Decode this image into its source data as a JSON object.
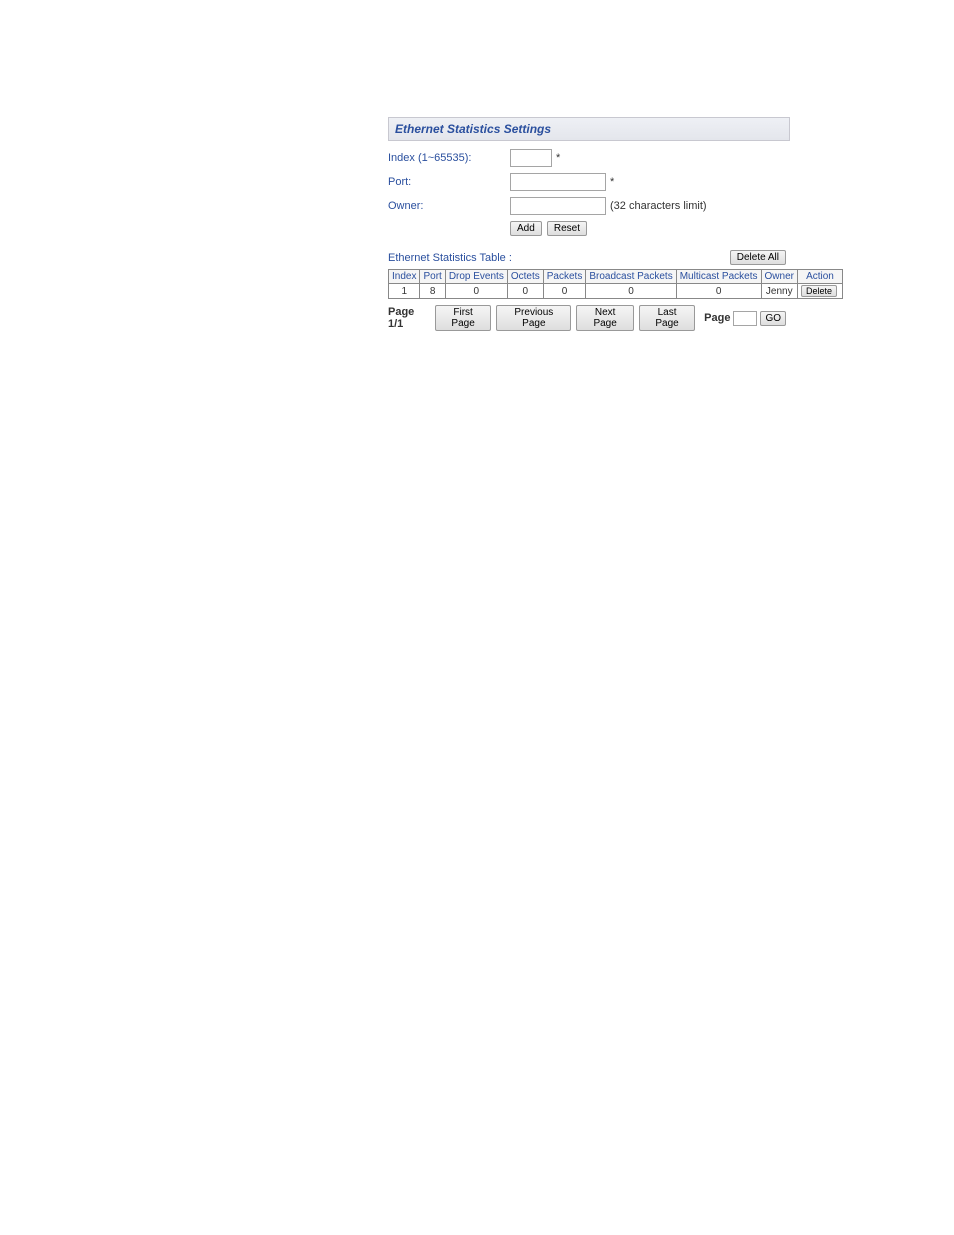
{
  "title": "Ethernet Statistics Settings",
  "form": {
    "index_label": "Index (1~65535):",
    "index_value": "",
    "index_star": "*",
    "port_label": "Port:",
    "port_value": "",
    "port_star": "*",
    "owner_label": "Owner:",
    "owner_value": "",
    "owner_hint": "(32 characters limit)",
    "add_btn": "Add",
    "reset_btn": "Reset"
  },
  "table": {
    "label": "Ethernet Statistics Table :",
    "delete_all_btn": "Delete All",
    "headers": {
      "index": "Index",
      "port": "Port",
      "drop_events": "Drop Events",
      "octets": "Octets",
      "packets": "Packets",
      "broadcast": "Broadcast Packets",
      "multicast": "Multicast Packets",
      "owner": "Owner",
      "action": "Action"
    },
    "rows": [
      {
        "index": "1",
        "port": "8",
        "drop_events": "0",
        "octets": "0",
        "packets": "0",
        "broadcast": "0",
        "multicast": "0",
        "owner": "Jenny",
        "action": "Delete"
      }
    ]
  },
  "pager": {
    "page_indicator": "Page 1/1",
    "first_btn": "First Page",
    "prev_btn": "Previous Page",
    "next_btn": "Next Page",
    "last_btn": "Last Page",
    "page_label": "Page",
    "page_value": "",
    "go_btn": "GO"
  }
}
